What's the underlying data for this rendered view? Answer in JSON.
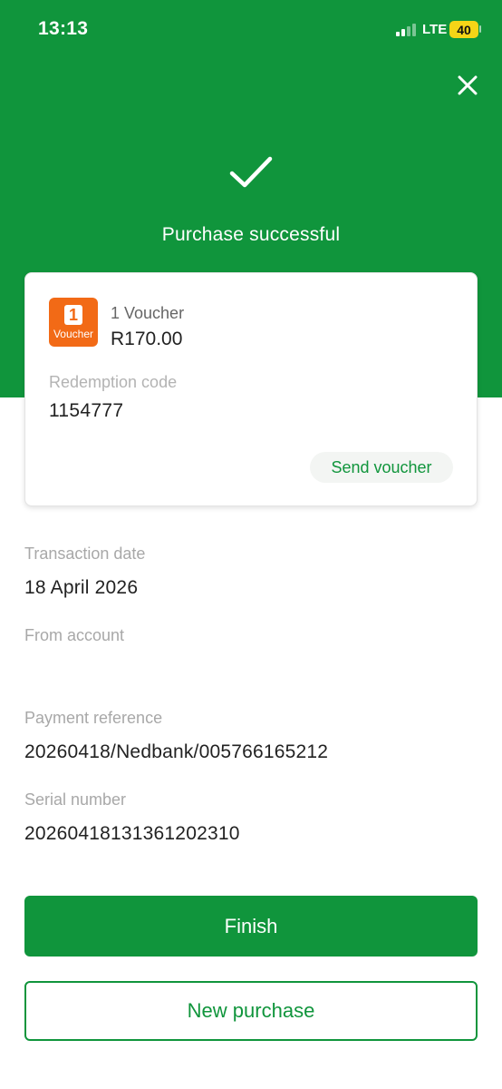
{
  "status_bar": {
    "time": "13:13",
    "network": "LTE",
    "battery": "40"
  },
  "header": {
    "title": "Purchase successful",
    "background_color": "#10953c"
  },
  "voucher_card": {
    "logo_digit": "1",
    "logo_text": "Voucher",
    "logo_color": "#f26a16",
    "name": "1 Voucher",
    "amount": "R170.00",
    "redemption_label": "Redemption code",
    "redemption_code_visible": "1154777",
    "send_button_label": "Send voucher"
  },
  "details": [
    {
      "label": "Transaction date",
      "value": "18 April 2026"
    },
    {
      "label": "From account",
      "value": ""
    },
    {
      "label": "Payment reference",
      "value": "20260418/Nedbank/005766165212"
    },
    {
      "label": "Serial number",
      "value": "20260418131361202310"
    }
  ],
  "actions": {
    "finish_label": "Finish",
    "new_purchase_label": "New purchase"
  },
  "icons": [
    "close-icon",
    "checkmark-icon",
    "signal-icon",
    "battery-icon"
  ]
}
